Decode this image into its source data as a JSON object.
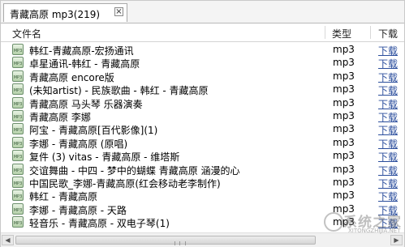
{
  "tab": {
    "title": "青藏高原 mp3(219)",
    "close_glyph": "×"
  },
  "columns": {
    "name": "文件名",
    "type": "类型",
    "download": "下载"
  },
  "rows": [
    {
      "name": "韩红-青藏高原-宏扬通讯",
      "type": "mp3",
      "download": "下载"
    },
    {
      "name": "卓星通讯-韩红 - 青藏高原",
      "type": "mp3",
      "download": "下载"
    },
    {
      "name": "青藏高原 encore版",
      "type": "mp3",
      "download": "下载"
    },
    {
      "name": "(未知artist) - 民族歌曲 - 韩红 - 青藏高原",
      "type": "mp3",
      "download": "下载"
    },
    {
      "name": "青藏高原 马头琴 乐器演奏",
      "type": "mp3",
      "download": "下载"
    },
    {
      "name": "青藏高原 李娜",
      "type": "mp3",
      "download": "下载"
    },
    {
      "name": "阿宝 - 青藏高原[百代影像](1)",
      "type": "mp3",
      "download": "下载"
    },
    {
      "name": "李娜 - 青藏高原 (原唱)",
      "type": "mp3",
      "download": "下载"
    },
    {
      "name": "复件 (3) vitas - 青藏高原 - 维塔斯",
      "type": "mp3",
      "download": "下载"
    },
    {
      "name": "交谊舞曲 - 中四 - 梦中的蝴蝶 青藏高原 涵漫的心",
      "type": "mp3",
      "download": "下载"
    },
    {
      "name": "中国民歌_李娜-青藏高原(红会移动老李制作)",
      "type": "mp3",
      "download": "下载"
    },
    {
      "name": "韩红 - 青藏高原",
      "type": "mp3",
      "download": "下载"
    },
    {
      "name": "李娜 - 青藏高原 - 天路",
      "type": "mp3",
      "download": "下载"
    },
    {
      "name": "轻音乐 - 青藏高原 - 双电子琴(1)",
      "type": "mp3",
      "download": "下载"
    }
  ],
  "watermark": {
    "text": "系统之家",
    "url": "XITONGZHIJIA.NET"
  },
  "icons": {
    "file": "mp3-file-icon",
    "close": "close-icon",
    "scroll_left": "arrow-left-icon",
    "scroll_right": "arrow-right-icon"
  }
}
